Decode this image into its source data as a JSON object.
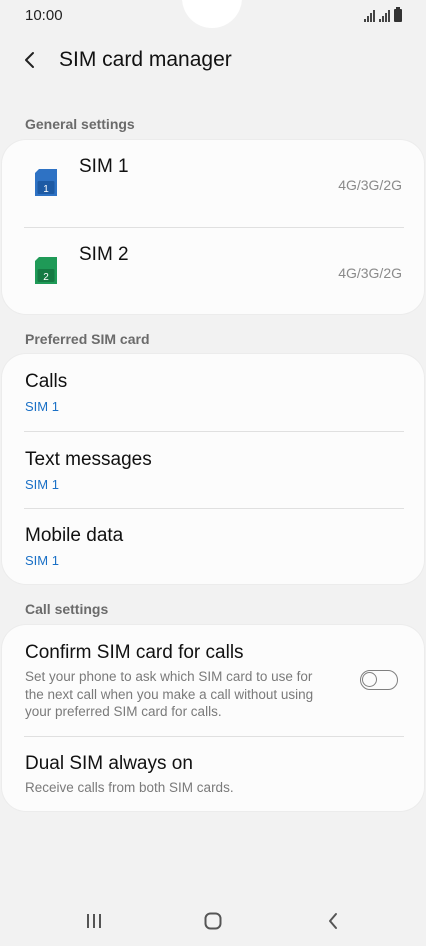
{
  "status_bar": {
    "time": "10:00"
  },
  "header": {
    "title": "SIM card manager"
  },
  "sections": {
    "general": "General settings",
    "preferred": "Preferred SIM card",
    "call": "Call settings"
  },
  "sims": [
    {
      "name": "SIM 1",
      "number": "1",
      "network": "4G/3G/2G",
      "color": "#2e72c4"
    },
    {
      "name": "SIM 2",
      "number": "2",
      "network": "4G/3G/2G",
      "color": "#1f9a57"
    }
  ],
  "preferred": [
    {
      "label": "Calls",
      "value": "SIM 1"
    },
    {
      "label": "Text messages",
      "value": "SIM 1"
    },
    {
      "label": "Mobile data",
      "value": "SIM 1"
    }
  ],
  "call_settings": [
    {
      "title": "Confirm SIM card for calls",
      "description_lines": [
        "Set your phone to ask which SIM card to use for",
        "the next call when you make a call without using",
        "your preferred SIM card for calls."
      ],
      "toggle_on": false
    },
    {
      "title": "Dual SIM always on",
      "description_lines": [
        "Receive calls from both SIM cards."
      ]
    }
  ],
  "accent_color": "#1a70c6"
}
